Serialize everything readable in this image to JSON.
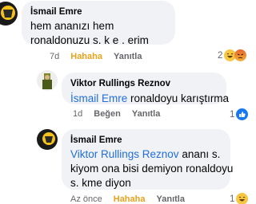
{
  "comments": [
    {
      "author": "İsmail Emre",
      "text": "hem ananızı hem ronaldonuzu s. k e . erim",
      "time": "7d",
      "reaction_link": "Hahaha",
      "reply": "Yanıtla",
      "reaction_count": "2",
      "reactions": [
        "laugh-emoji",
        "angry-emoji"
      ]
    },
    {
      "author": "Viktor Rullings Reznov",
      "mention": "İsmail Emre",
      "text": " ronaldoyu karıştırma",
      "time": "1d",
      "reaction_link": "Beğen",
      "reply": "Yanıtla",
      "reaction_count": "1",
      "reactions": [
        "like-emoji"
      ]
    },
    {
      "author": "İsmail Emre",
      "mention": "Viktor Rullings Reznov",
      "text_line1": " ananı s.",
      "text_line2": "kiyom ona bisi demiyon ronaldoyu",
      "text_line3": "s. kme diyon",
      "time": "Az önce",
      "reaction_link": "Hahaha",
      "reply": "Yanıtla",
      "reaction_count": "1",
      "reactions": [
        "laugh-emoji"
      ]
    }
  ],
  "colors": {
    "bubble": "#f0f2f5",
    "mention": "#216fdb",
    "haha": "#e8a21e",
    "meta": "#65676b",
    "like": "#1877f2"
  }
}
